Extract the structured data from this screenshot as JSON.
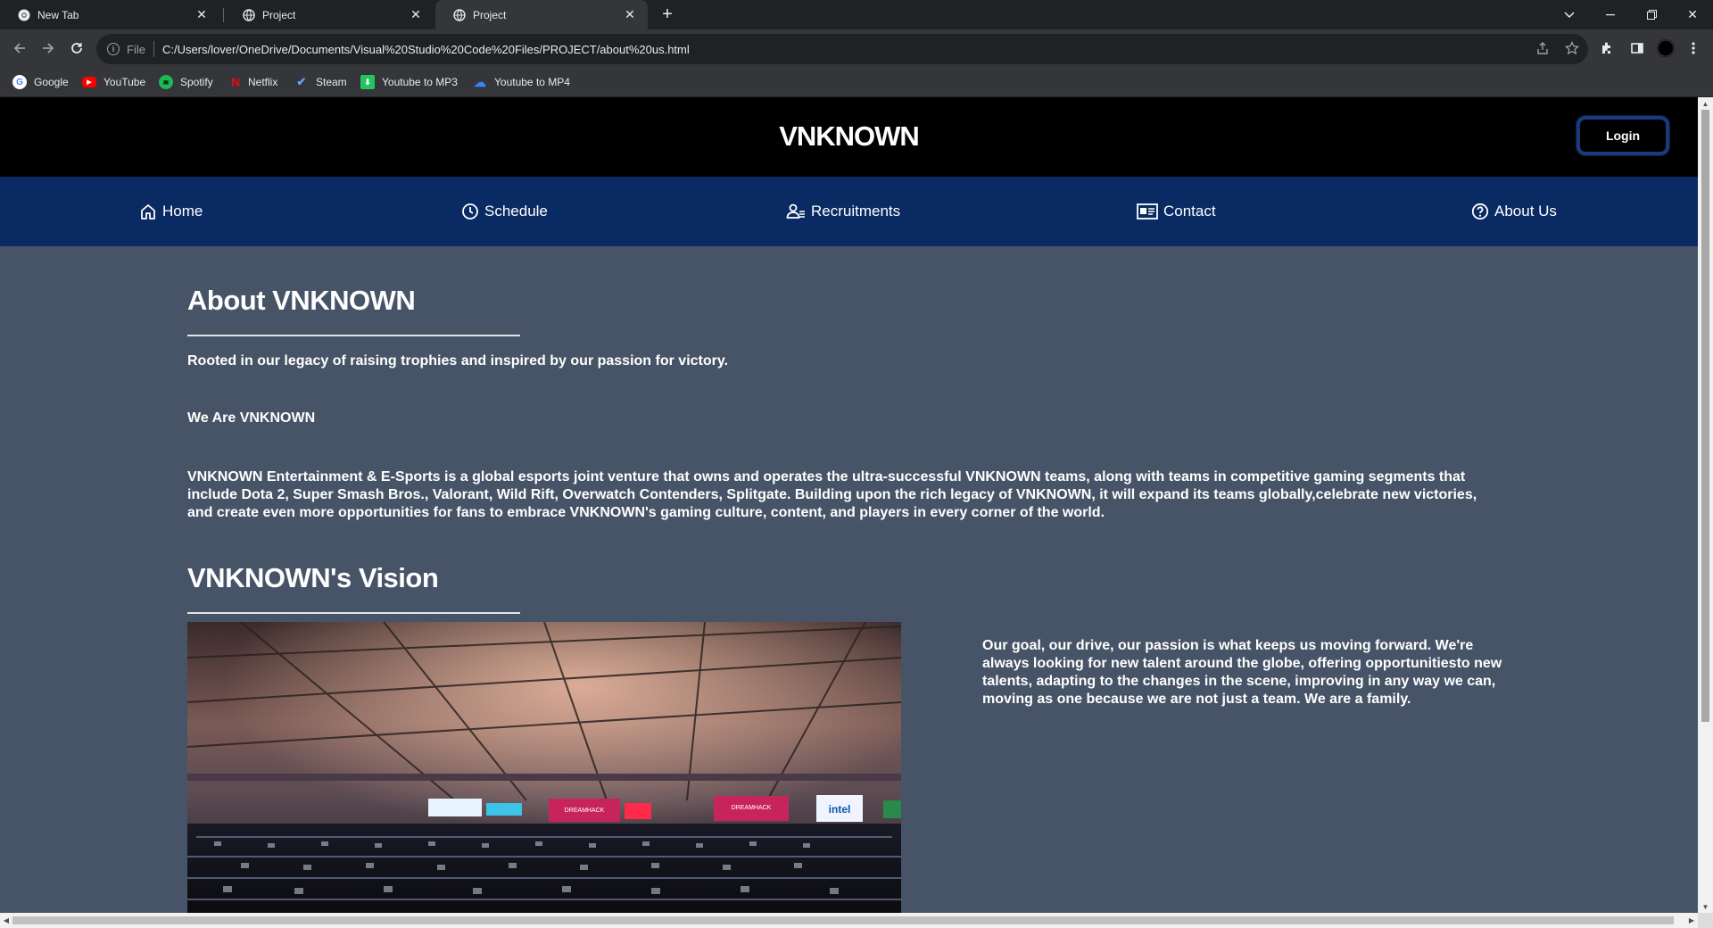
{
  "browser": {
    "tabs": [
      {
        "label": "New Tab",
        "active": false
      },
      {
        "label": "Project",
        "active": false
      },
      {
        "label": "Project",
        "active": true
      }
    ],
    "address": {
      "scheme_label": "File",
      "url": "C:/Users/lover/OneDrive/Documents/Visual%20Studio%20Code%20Files/PROJECT/about%20us.html"
    },
    "bookmarks": [
      {
        "label": "Google",
        "icon": "google-icon",
        "color": "#ffffff"
      },
      {
        "label": "YouTube",
        "icon": "youtube-icon",
        "color": "#ff0000"
      },
      {
        "label": "Spotify",
        "icon": "spotify-icon",
        "color": "#1db954"
      },
      {
        "label": "Netflix",
        "icon": "netflix-icon",
        "color": "#e50914"
      },
      {
        "label": "Steam",
        "icon": "steam-icon",
        "color": "#3b82f6"
      },
      {
        "label": "Youtube to MP3",
        "icon": "download-icon",
        "color": "#22c55e"
      },
      {
        "label": "Youtube to MP4",
        "icon": "cloud-icon",
        "color": "#3b82f6"
      }
    ]
  },
  "site": {
    "title": "VNKNOWN",
    "login_label": "Login",
    "nav": [
      {
        "label": "Home",
        "icon": "home-icon"
      },
      {
        "label": "Schedule",
        "icon": "clock-icon"
      },
      {
        "label": "Recruitments",
        "icon": "users-icon"
      },
      {
        "label": "Contact",
        "icon": "contact-card-icon"
      },
      {
        "label": "About Us",
        "icon": "question-icon"
      }
    ],
    "colors": {
      "header_bg": "#000000",
      "nav_bg": "#0a2a63",
      "page_bg": "#475467"
    }
  },
  "about": {
    "heading": "About VNKNOWN",
    "tagline": "Rooted in our legacy of raising trophies and inspired by our passion for victory.",
    "subheading": "We Are VNKNOWN",
    "paragraph": "VNKNOWN Entertainment & E-Sports is a global esports joint venture that owns and operates the ultra-successful VNKNOWN teams, along with teams in competitive gaming segments that include Dota 2, Super Smash Bros., Valorant, Wild Rift, Overwatch Contenders, Splitgate. Building upon the rich legacy of VNKNOWN, it will expand its teams globally,celebrate new victories, and create even more opportunities for fans to embrace VNKNOWN's gaming culture, content, and players in every corner of the world."
  },
  "vision": {
    "heading": "VNKNOWN's Vision",
    "text": "Our goal, our drive, our passion is what keeps us moving forward. We're always looking for new talent around the globe, offering opportunitiesto new talents, adapting to the changes in the scene, improving in any way we can, moving as one because we are not just a team. We are a family.",
    "image_signs": [
      "DREAMHACK",
      "DREAMHACK",
      "intel"
    ]
  }
}
